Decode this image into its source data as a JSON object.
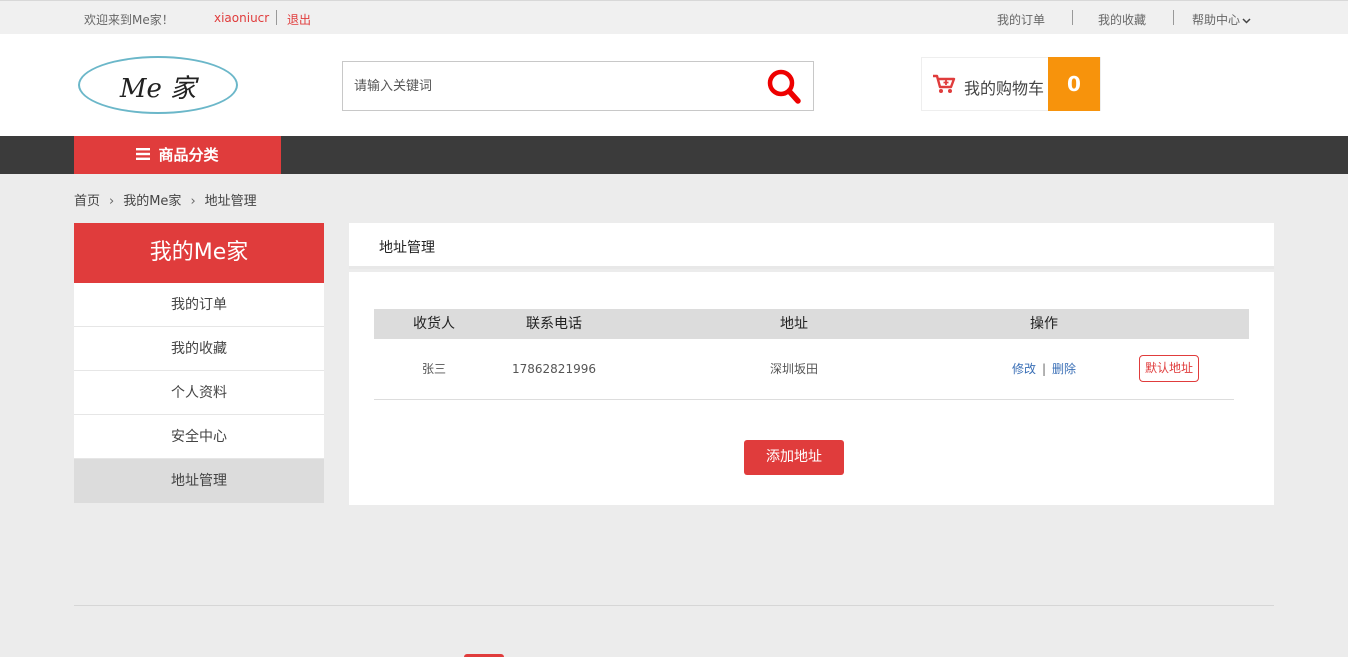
{
  "topbar": {
    "welcome": "欢迎来到Me家！",
    "username": "xiaoniucr",
    "logout": "退出",
    "my_orders": "我的订单",
    "my_favorites": "我的收藏",
    "help_center": "帮助中心"
  },
  "header": {
    "logo_text": "Me 家",
    "search_placeholder": "请输入关键词",
    "cart_label": "我的购物车",
    "cart_count": "0"
  },
  "nav": {
    "category_label": "商品分类"
  },
  "breadcrumb": [
    "首页",
    "我的Me家",
    "地址管理"
  ],
  "sidebar": {
    "title": "我的Me家",
    "items": [
      {
        "label": "我的订单"
      },
      {
        "label": "我的收藏"
      },
      {
        "label": "个人资料"
      },
      {
        "label": "安全中心"
      },
      {
        "label": "地址管理"
      }
    ]
  },
  "main": {
    "title": "地址管理",
    "columns": [
      "收货人",
      "联系电话",
      "地址",
      "操作"
    ],
    "rows": [
      {
        "receiver": "张三",
        "phone": "17862821996",
        "address": "深圳坂田",
        "edit": "修改",
        "delete": "删除",
        "default": "默认地址"
      }
    ],
    "add_button": "添加地址"
  },
  "colors": {
    "accent": "#e03c3c",
    "cart_badge": "#f7930c",
    "nav_bg": "#3b3b3b",
    "link": "#3a6fb6"
  }
}
